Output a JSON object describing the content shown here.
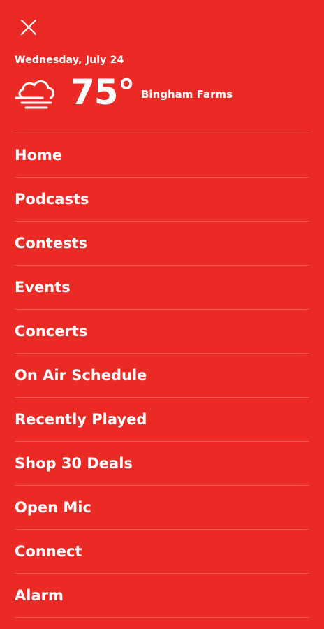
{
  "header": {
    "close_icon": "close-icon",
    "date": "Wednesday, July 24",
    "weather_icon": "cloud-fog-icon",
    "temperature": "75°",
    "location": "Bingham Farms"
  },
  "colors": {
    "background": "#ec2a25",
    "text": "#ffffff"
  },
  "menu": {
    "items": [
      {
        "label": "Home"
      },
      {
        "label": "Podcasts"
      },
      {
        "label": "Contests"
      },
      {
        "label": "Events"
      },
      {
        "label": "Concerts"
      },
      {
        "label": "On Air Schedule"
      },
      {
        "label": "Recently Played"
      },
      {
        "label": "Shop 30 Deals"
      },
      {
        "label": "Open Mic"
      },
      {
        "label": "Connect"
      },
      {
        "label": "Alarm"
      }
    ]
  }
}
